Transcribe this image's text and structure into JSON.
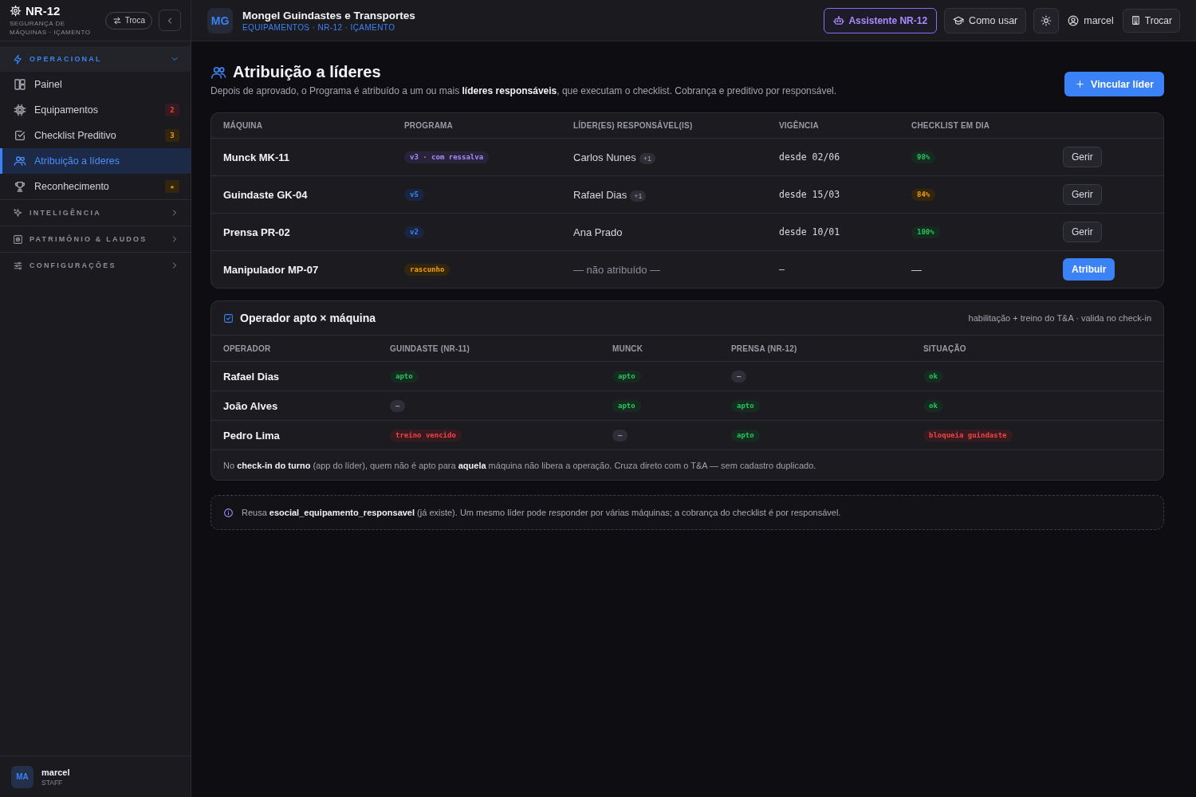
{
  "sidebar": {
    "brand": {
      "title": "NR-12",
      "subtitle": "SEGURANÇA DE MÁQUINAS · IÇAMENTO"
    },
    "switch_button": "Troca",
    "groups": [
      {
        "label": "OPERACIONAL",
        "expanded": true,
        "items": [
          {
            "label": "Painel",
            "selected": false
          },
          {
            "label": "Equipamentos",
            "selected": false,
            "badge": {
              "text": "2",
              "kind": "danger"
            }
          },
          {
            "label": "Checklist Preditivo",
            "selected": false,
            "badge": {
              "text": "3",
              "kind": "warning"
            }
          },
          {
            "label": "Atribuição a líderes",
            "selected": true
          },
          {
            "label": "Reconhecimento",
            "selected": false,
            "badge": {
              "text": "★",
              "kind": "warning"
            }
          }
        ]
      },
      {
        "label": "INTELIGÊNCIA",
        "expanded": false
      },
      {
        "label": "PATRIMÔNIO & LAUDOS",
        "expanded": false
      },
      {
        "label": "CONFIGURAÇÕES",
        "expanded": false
      }
    ],
    "user": {
      "initials": "MA",
      "name": "marcel",
      "role": "STAFF"
    }
  },
  "topbar": {
    "company": {
      "initials": "MG",
      "name": "Mongel Guindastes e Transportes",
      "breadcrumb": "EQUIPAMENTOS · NR-12 · IÇAMENTO"
    },
    "actions": [
      {
        "kind": "assistant",
        "label": "Assistente NR-12"
      },
      {
        "kind": "help",
        "label": "Como usar"
      },
      {
        "kind": "theme"
      },
      {
        "kind": "user",
        "label": "marcel"
      },
      {
        "kind": "switch",
        "label": "Trocar"
      }
    ]
  },
  "page": {
    "title": "Atribuição a líderes",
    "description": "Depois de aprovado, o Programa é atribuído a um ou mais **líderes responsáveis**, que executam o checklist. Cobrança e preditivo por responsável.",
    "primary_button": "Vincular líder"
  },
  "assignments": {
    "columns": [
      "MÁQUINA",
      "PROGRAMA",
      "LÍDER(ES) RESPONSÁVEL(IS)",
      "VIGÊNCIA",
      "CHECKLIST EM DIA"
    ],
    "rows": [
      {
        "machine": "Munck MK-11",
        "program": {
          "text": "v3 · com ressalva",
          "kind": "accent"
        },
        "leader": "Carlos Nunes",
        "assigned": true,
        "extra_leaders": "+1",
        "since": "desde 02/06",
        "checklist": {
          "text": "98%",
          "kind": "success"
        },
        "action": {
          "label": "Gerir",
          "kind": "secondary"
        }
      },
      {
        "machine": "Guindaste GK-04",
        "program": {
          "text": "v5",
          "kind": "info"
        },
        "leader": "Rafael Dias",
        "assigned": true,
        "extra_leaders": "+1",
        "since": "desde 15/03",
        "checklist": {
          "text": "84%",
          "kind": "warning"
        },
        "action": {
          "label": "Gerir",
          "kind": "secondary"
        }
      },
      {
        "machine": "Prensa PR-02",
        "program": {
          "text": "v2",
          "kind": "info"
        },
        "leader": "Ana Prado",
        "assigned": true,
        "since": "desde 10/01",
        "checklist": {
          "text": "100%",
          "kind": "success"
        },
        "action": {
          "label": "Gerir",
          "kind": "secondary"
        }
      },
      {
        "machine": "Manipulador MP-07",
        "program": {
          "text": "rascunho",
          "kind": "warning"
        },
        "leader": "— não atribuído —",
        "assigned": false,
        "since": "—",
        "checklist": {
          "text": "—",
          "kind": "plain"
        },
        "action": {
          "label": "Atribuir",
          "kind": "primary"
        }
      }
    ]
  },
  "operator_fitness": {
    "title": "Operador apto × máquina",
    "note": "habilitação + treino do T&A · valida no check-in",
    "columns": [
      "OPERADOR",
      "GUINDASTE (NR-11)",
      "MUNCK",
      "PRENSA (NR-12)",
      "SITUAÇÃO"
    ],
    "rows": [
      {
        "cells": [
          {
            "kind": "name",
            "text": "Rafael Dias"
          },
          {
            "kind": "success",
            "text": "apto"
          },
          {
            "kind": "success",
            "text": "apto"
          },
          {
            "kind": "neutral",
            "text": "–"
          },
          {
            "kind": "success",
            "text": "ok"
          }
        ]
      },
      {
        "cells": [
          {
            "kind": "name",
            "text": "João Alves"
          },
          {
            "kind": "neutral",
            "text": "–"
          },
          {
            "kind": "success",
            "text": "apto"
          },
          {
            "kind": "success",
            "text": "apto"
          },
          {
            "kind": "success",
            "text": "ok"
          }
        ]
      },
      {
        "cells": [
          {
            "kind": "name",
            "text": "Pedro Lima"
          },
          {
            "kind": "danger",
            "text": "treino vencido"
          },
          {
            "kind": "neutral",
            "text": "–"
          },
          {
            "kind": "success",
            "text": "apto"
          },
          {
            "kind": "danger",
            "text": "bloqueia guindaste"
          }
        ]
      }
    ],
    "footer": "No **check-in do turno** (app do líder), quem não é apto para **aquela** máquina não libera a operação. Cruza direto com o T&A — sem cadastro duplicado."
  },
  "info_note": "Reusa **esocial_equipamento_responsavel** (já existe). Um mesmo líder pode responder por várias máquinas; a cobrança do checklist é por responsável."
}
